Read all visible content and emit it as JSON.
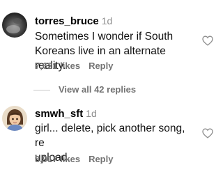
{
  "comments": [
    {
      "username": "torres_bruce",
      "time": "1d",
      "text_lines": [
        "Sometimes I wonder if South",
        "Koreans live in an alternate reality."
      ],
      "likes": "7,621 likes",
      "reply_label": "Reply",
      "avatar_icon": "avatar-photo",
      "like_icon": "heart-outline-icon"
    },
    {
      "username": "smwh_sft",
      "time": "1d",
      "text_lines": [
        "girl... delete, pick another song, re",
        "upload."
      ],
      "likes": "3,917 likes",
      "reply_label": "Reply",
      "avatar_icon": "avatar-illustration",
      "like_icon": "heart-outline-icon"
    }
  ],
  "view_replies": {
    "label": "View all 42 replies"
  },
  "colors": {
    "primary_text": "#000000",
    "secondary_text": "#737373",
    "timestamp": "#8e8e8e",
    "background": "#ffffff"
  }
}
